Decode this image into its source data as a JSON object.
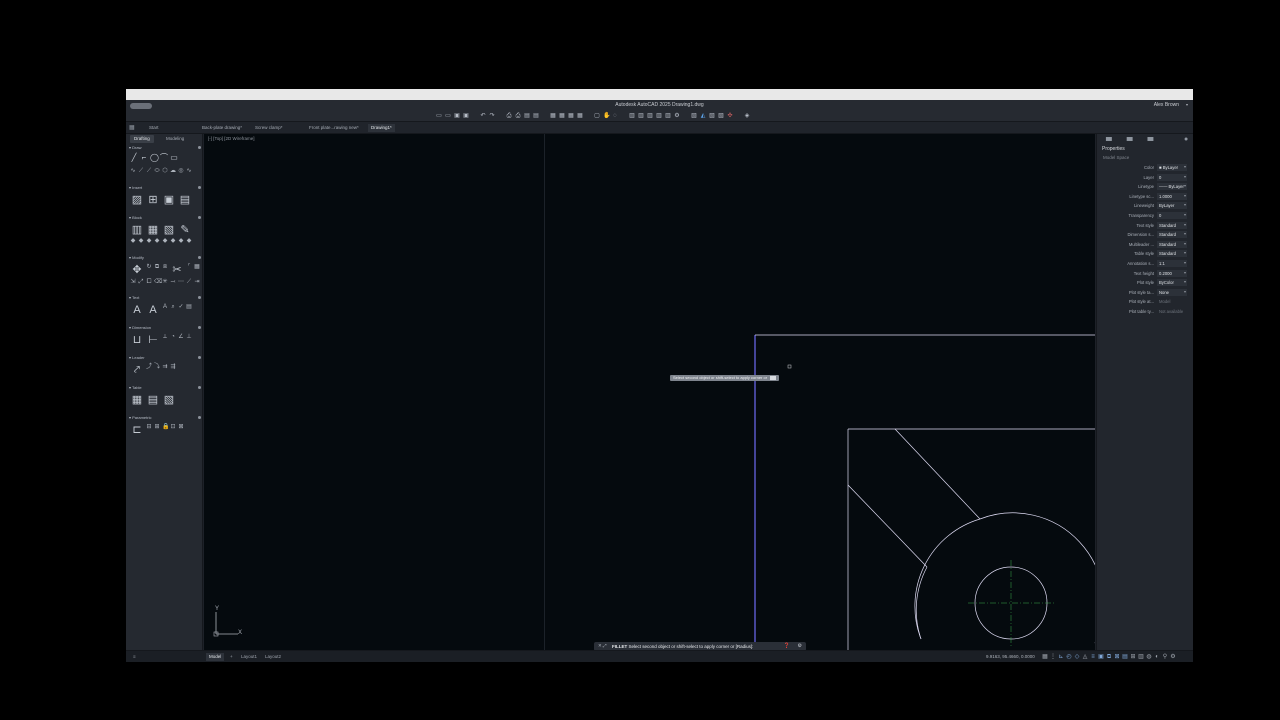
{
  "window": {
    "title": "Autodesk AutoCAD 2025 Drawing1.dwg",
    "user": "Alex Brown"
  },
  "tabs": [
    {
      "label": "Start"
    },
    {
      "label": "Back-plate drawing*"
    },
    {
      "label": "Screw clamp*"
    },
    {
      "label": "Front plate...rawing new*"
    },
    {
      "label": "Drawing1*"
    }
  ],
  "palette": {
    "tabs": [
      "Drafting",
      "Modeling"
    ],
    "sections": [
      "Draw",
      "Insert",
      "Block",
      "Modify",
      "Text",
      "Dimension",
      "Leader",
      "Table",
      "Parametric"
    ]
  },
  "canvas": {
    "view_label": "[-] [Top] [2D Wireframe]",
    "ucs_x": "X",
    "ucs_y": "Y",
    "tooltip": "Select second object or shift-select to apply corner or"
  },
  "command_line": {
    "close": "✕ ⤢",
    "command": "FILLET",
    "prompt": "Select second object or shift-select to apply corner or [Radius]:"
  },
  "properties": {
    "title": "Properties",
    "subtitle": "Model Space",
    "rows": [
      {
        "label": "Color",
        "value": "■ ByLayer"
      },
      {
        "label": "Layer",
        "value": "0"
      },
      {
        "label": "Linetype",
        "value": "—— ByLayer"
      },
      {
        "label": "Linetype sc...",
        "value": "1.0000"
      },
      {
        "label": "Lineweight",
        "value": "ByLayer"
      },
      {
        "label": "Transparency",
        "value": "0"
      },
      {
        "label": "Text style",
        "value": "Standard"
      },
      {
        "label": "Dimension s...",
        "value": "Standard"
      },
      {
        "label": "Multileader ...",
        "value": "Standard"
      },
      {
        "label": "Table style",
        "value": "Standard"
      },
      {
        "label": "Annotation s...",
        "value": "1:1"
      },
      {
        "label": "Text height",
        "value": "0.2000"
      },
      {
        "label": "Plot style",
        "value": "ByColor"
      },
      {
        "label": "Plot style ta...",
        "value": "None"
      },
      {
        "label": "Plot style at...",
        "value": "Model",
        "dim": true
      },
      {
        "label": "Plot table ty...",
        "value": "Not available",
        "dim": true
      }
    ]
  },
  "status": {
    "layout_tabs": [
      "Model",
      "Layout1",
      "Layout2"
    ],
    "coords": "9.9163, 95.4660, 0.0000"
  },
  "colors": {
    "geometry": "#dfdcf4",
    "selected": "#6e6cf5",
    "centerline": "#3aa84a"
  }
}
